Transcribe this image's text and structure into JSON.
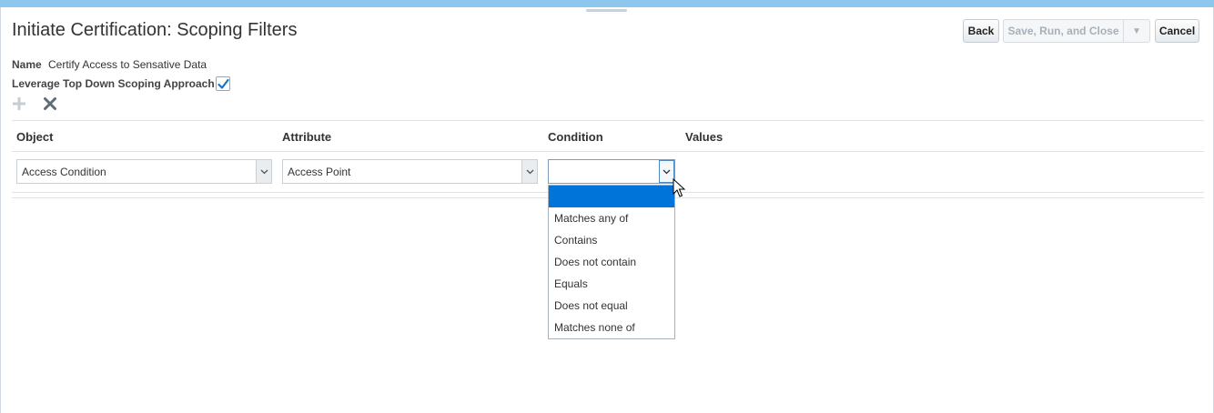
{
  "page": {
    "title": "Initiate Certification: Scoping Filters"
  },
  "toolbar": {
    "back_label": "Back",
    "save_run_close_label": "Save, Run, and Close",
    "save_menu_icon": "triangle-down-icon",
    "cancel_label": "Cancel"
  },
  "form": {
    "name_label": "Name",
    "name_value": "Certify Access to Sensative Data",
    "top_down_label": "Leverage Top Down Scoping Approach",
    "top_down_checked": true
  },
  "actions": {
    "add_icon": "plus-icon",
    "delete_icon": "x-icon"
  },
  "table": {
    "headers": {
      "object": "Object",
      "attribute": "Attribute",
      "condition": "Condition",
      "values": "Values"
    },
    "row": {
      "object": "Access Condition",
      "attribute": "Access Point",
      "condition": ""
    }
  },
  "condition_options": [
    "",
    "Matches any of",
    "Contains",
    "Does not contain",
    "Equals",
    "Does not equal",
    "Matches none of"
  ],
  "colors": {
    "top_bar": "#8ec7ee",
    "selected_option": "#0074d8",
    "checkbox_check": "#1a73c8"
  }
}
